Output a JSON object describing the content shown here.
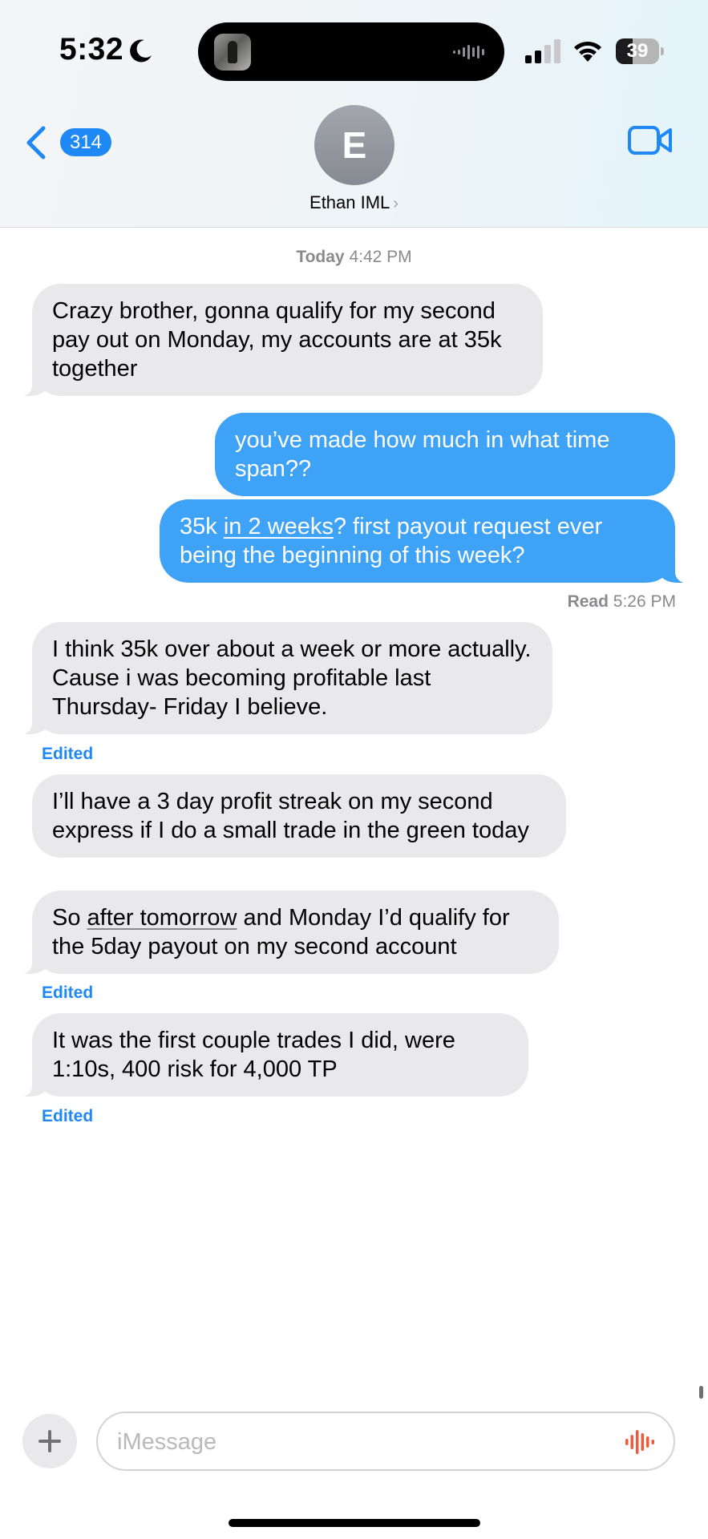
{
  "status_bar": {
    "time": "5:32",
    "focus_icon": "moon-icon",
    "battery_level": "39",
    "battery_fraction": 0.39
  },
  "header": {
    "back_badge": "314",
    "avatar_initial": "E",
    "contact_name": "Ethan IML",
    "contact_chevron": "›",
    "video_icon": "video-camera-icon"
  },
  "thread": {
    "timestamp_day": "Today",
    "timestamp_time": "4:42 PM",
    "messages": [
      {
        "from": "them",
        "text": "Crazy brother, gonna qualify for my second pay out on Monday, my accounts are at 35k together"
      },
      {
        "from": "me",
        "text": "you’ve made how much in what time span??"
      },
      {
        "from": "me",
        "text_before": "35k ",
        "text_link": "in 2 weeks",
        "text_after": "? first payout request ever being the beginning of this week?"
      },
      {
        "from": "them",
        "text": "I think 35k over about a week or more actually. Cause i was becoming profitable last Thursday- Friday I believe."
      },
      {
        "from": "them",
        "text": "I’ll have a 3 day profit streak on my second express if I do a small trade in the green today"
      },
      {
        "from": "them",
        "text_before": "So ",
        "text_link": "after tomorrow",
        "text_after": " and Monday I’d qualify for the 5day payout on my second account"
      },
      {
        "from": "them",
        "text": "It was the first couple trades I did, were 1:10s, 400 risk for 4,000 TP"
      }
    ],
    "read_label": "Read",
    "read_time": "5:26 PM",
    "edited_label": "Edited"
  },
  "composer": {
    "placeholder": "iMessage",
    "plus_icon": "plus-icon",
    "audio_icon": "audio-waveform-icon"
  },
  "colors": {
    "accent": "#1e88f5",
    "outgoing_bubble": "#3ea2f7",
    "incoming_bubble": "#e9e9eb",
    "audio_icon": "#f05a3c"
  }
}
